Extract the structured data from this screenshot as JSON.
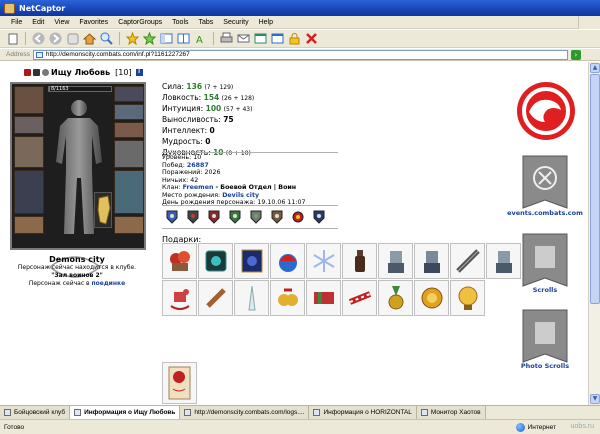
{
  "window": {
    "title": "NetCaptor"
  },
  "menu": [
    "File",
    "Edit",
    "View",
    "Favorites",
    "CaptorGroups",
    "Tools",
    "Tabs",
    "Security",
    "Help"
  ],
  "address": {
    "label": "Address",
    "url": "http://demonscity.combats.com/inf.pl?1161227267"
  },
  "character": {
    "name": "Ищу Любовь",
    "level": "[10]",
    "hp": "8/1163",
    "hp_fraction": 0.01,
    "city": "Demons city",
    "club_line1": "Персонаж сейчас находится в клубе.",
    "club_room": "\"Зал воинов 2\"",
    "club_line2_pre": "Персонаж сейчас в",
    "club_link": "поединке"
  },
  "stats": [
    {
      "label": "Сила:",
      "value": "136",
      "extra": "(7 + 129)",
      "green": true
    },
    {
      "label": "Ловкость:",
      "value": "154",
      "extra": "(26 + 128)",
      "green": true
    },
    {
      "label": "Интуиция:",
      "value": "100",
      "extra": "(57 + 43)",
      "green": true
    },
    {
      "label": "Выносливость:",
      "value": "75",
      "extra": "",
      "green": false
    },
    {
      "label": "Интеллект:",
      "value": "0",
      "extra": "",
      "green": false
    },
    {
      "label": "Мудрость:",
      "value": "0",
      "extra": "",
      "green": false
    },
    {
      "label": "Духовность:",
      "value": "10",
      "extra": "(0 + 10)",
      "green": true
    }
  ],
  "info": {
    "level_label": "Уровень:",
    "level": "10",
    "wins_label": "Побед:",
    "wins": "26887",
    "losses_label": "Поражений:",
    "losses": "2026",
    "draws_label": "Ничьих:",
    "draws": "42",
    "clan_label": "Клан:",
    "clan": "Freemen",
    "clan_rest": "- Боевой Отдел | Воин",
    "birthplace_label": "Место рождения:",
    "birthplace": "Devils city",
    "birthday_label": "День рождения персонажа:",
    "birthday": "19.10.06 11:07"
  },
  "gifts_label": "Подарки:",
  "gifts": [
    "gift-flowers",
    "gift-mirror",
    "gift-book",
    "gift-santa-hat",
    "gift-snowflake",
    "gift-bottle",
    "gift-knight-a",
    "gift-knight-b",
    "gift-scroll-sword",
    "gift-knight-c",
    "gift-rocking-horse",
    "gift-rolling-pin",
    "gift-icicle",
    "gift-bells",
    "gift-candy",
    "gift-cracker",
    "gift-medal",
    "gift-golden-coin",
    "gift-golden-disc"
  ],
  "right_links": {
    "site": "events.combats.com",
    "scrolls": "Scrolls",
    "photo": "Photo Scrolls"
  },
  "tabs": [
    {
      "label": "Бойцовский клуб",
      "active": false
    },
    {
      "label": "Информация о Ищу Любовь",
      "active": true
    },
    {
      "label": "http://demonscity.combats.com/logs....",
      "active": false
    },
    {
      "label": "Информация о HORIZONTAL",
      "active": false
    },
    {
      "label": "Монитор Хаотов",
      "active": false
    }
  ],
  "status": {
    "left": "Готово",
    "zone": "Интернет",
    "watermark": "uobs.ru"
  },
  "colors": {
    "titlebar": "#1845b5",
    "stat_green": "#2e7d2e",
    "link_blue": "#1a3f9c",
    "shield_red": "#d42020"
  }
}
